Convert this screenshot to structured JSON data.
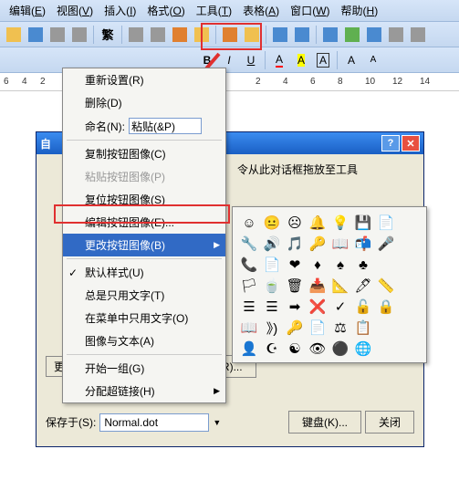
{
  "menubar": {
    "items": [
      {
        "label": "编辑",
        "key": "E"
      },
      {
        "label": "视图",
        "key": "V"
      },
      {
        "label": "插入",
        "key": "I"
      },
      {
        "label": "格式",
        "key": "O"
      },
      {
        "label": "工具",
        "key": "T"
      },
      {
        "label": "表格",
        "key": "A"
      },
      {
        "label": "窗口",
        "key": "W"
      },
      {
        "label": "帮助",
        "key": "H"
      }
    ]
  },
  "ruler": {
    "marks": [
      "6",
      "4",
      "2",
      "2",
      "4",
      "6",
      "8",
      "10",
      "12",
      "14"
    ]
  },
  "context_menu": {
    "reset": "重新设置(R)",
    "delete": "删除(D)",
    "name_label": "命名(N):",
    "name_value": "粘贴(&P)",
    "copy_icon": "复制按钮图像(C)",
    "paste_icon": "粘贴按钮图像(P)",
    "reset_icon": "复位按钮图像(S)",
    "edit_icon": "编辑按钮图像(E)...",
    "change_icon": "更改按钮图像(B)",
    "default_style": "默认样式(U)",
    "text_only": "总是只用文字(T)",
    "text_in_menu": "在菜单中只用文字(O)",
    "image_text": "图像与文本(A)",
    "begin_group": "开始一组(G)",
    "assign_link": "分配超链接(H)"
  },
  "dialog": {
    "title": "自",
    "hint": "令从此对话框拖放至工具",
    "change_selected": "更改所选内容(M)",
    "rearrange": "重排命令(R)...",
    "save_in_label": "保存于(S):",
    "save_in_value": "Normal.dot",
    "keyboard": "键盘(K)...",
    "close": "关闭"
  },
  "icon_grid": [
    [
      "☺",
      "😐",
      "☹",
      "🔔",
      "💡",
      "💾",
      "📄"
    ],
    [
      "🔧",
      "🔊",
      "🎵",
      "🔑",
      "📖",
      "📬",
      "🎤"
    ],
    [
      "📞",
      "📄",
      "❤",
      "♦",
      "♠",
      "♣"
    ],
    [
      "🏳",
      "🍵",
      "🗑",
      "📥",
      "📐",
      "🖊",
      "📏"
    ],
    [
      "☰",
      "☰",
      "➡",
      "❌",
      "✓",
      "🔓",
      "🔒"
    ],
    [
      "📖",
      "》)",
      "🔑",
      "📄",
      "⚖",
      "📋"
    ],
    [
      "👤",
      "☪",
      "☯",
      "👁",
      "⚫",
      "🌐"
    ]
  ]
}
